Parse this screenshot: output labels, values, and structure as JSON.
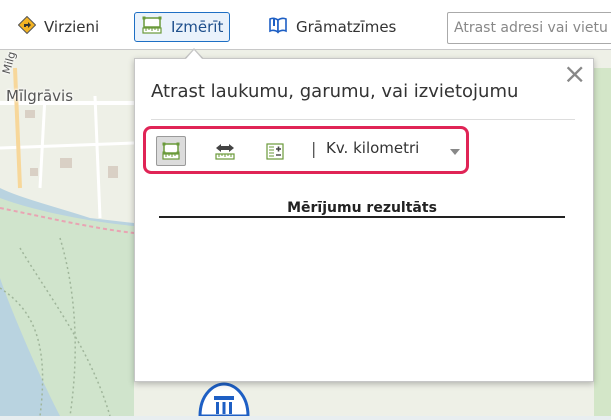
{
  "toolbar": {
    "directions_label": "Virzieni",
    "measure_label": "Izmērīt",
    "bookmarks_label": "Grāmatzīmes",
    "search_placeholder": "Atrast adresi vai vietu",
    "search_value": "",
    "icons": {
      "directions": "directions-diamond-icon",
      "measure": "ruler-icon",
      "bookmarks": "open-book-icon"
    },
    "accent_color": "#1e6fc4"
  },
  "map": {
    "labels": [
      "Mīlgrāvis",
      "Milg"
    ],
    "colors": {
      "land": "#f2efe9",
      "water": "#b4d0df",
      "park": "#cde3c4"
    }
  },
  "measure_panel": {
    "title": "Atrast laukumu, garumu, vai izvietojumu",
    "tools": [
      {
        "name": "area",
        "icon": "area-measure-icon",
        "selected": true
      },
      {
        "name": "distance",
        "icon": "distance-measure-icon",
        "selected": false
      },
      {
        "name": "location",
        "icon": "location-measure-icon",
        "selected": false
      }
    ],
    "separator": "|",
    "unit_selected": "Kv. kilometri",
    "results_title": "Mērījumu rezultāts",
    "highlight_color": "#e02456"
  }
}
